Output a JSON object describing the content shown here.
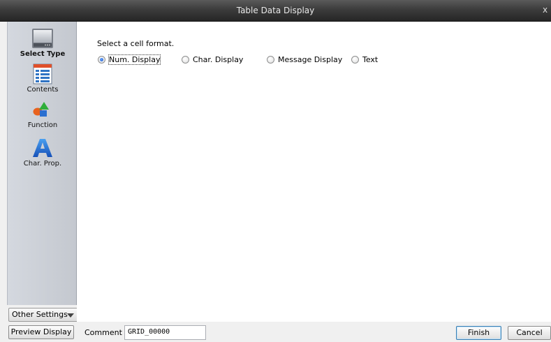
{
  "window": {
    "title": "Table Data Display",
    "close_glyph": "x"
  },
  "sidebar": {
    "items": [
      {
        "label": "Select Type",
        "icon": "screen-icon",
        "selected": true
      },
      {
        "label": "Contents",
        "icon": "table-list-icon",
        "selected": false
      },
      {
        "label": "Function",
        "icon": "shapes-icon",
        "selected": false
      },
      {
        "label": "Char. Prop.",
        "icon": "letter-a-icon",
        "selected": false
      }
    ],
    "other_settings": "Other Settings"
  },
  "main": {
    "prompt": "Select a cell format.",
    "formats": [
      {
        "label": "Num. Display",
        "checked": true
      },
      {
        "label": "Char. Display",
        "checked": false
      },
      {
        "label": "Message Display",
        "checked": false
      },
      {
        "label": "Text",
        "checked": false
      }
    ]
  },
  "footer": {
    "preview_label": "Preview Display",
    "comment_label": "Comment",
    "comment_value": "GRID_00000",
    "finish_label": "Finish",
    "cancel_label": "Cancel"
  }
}
